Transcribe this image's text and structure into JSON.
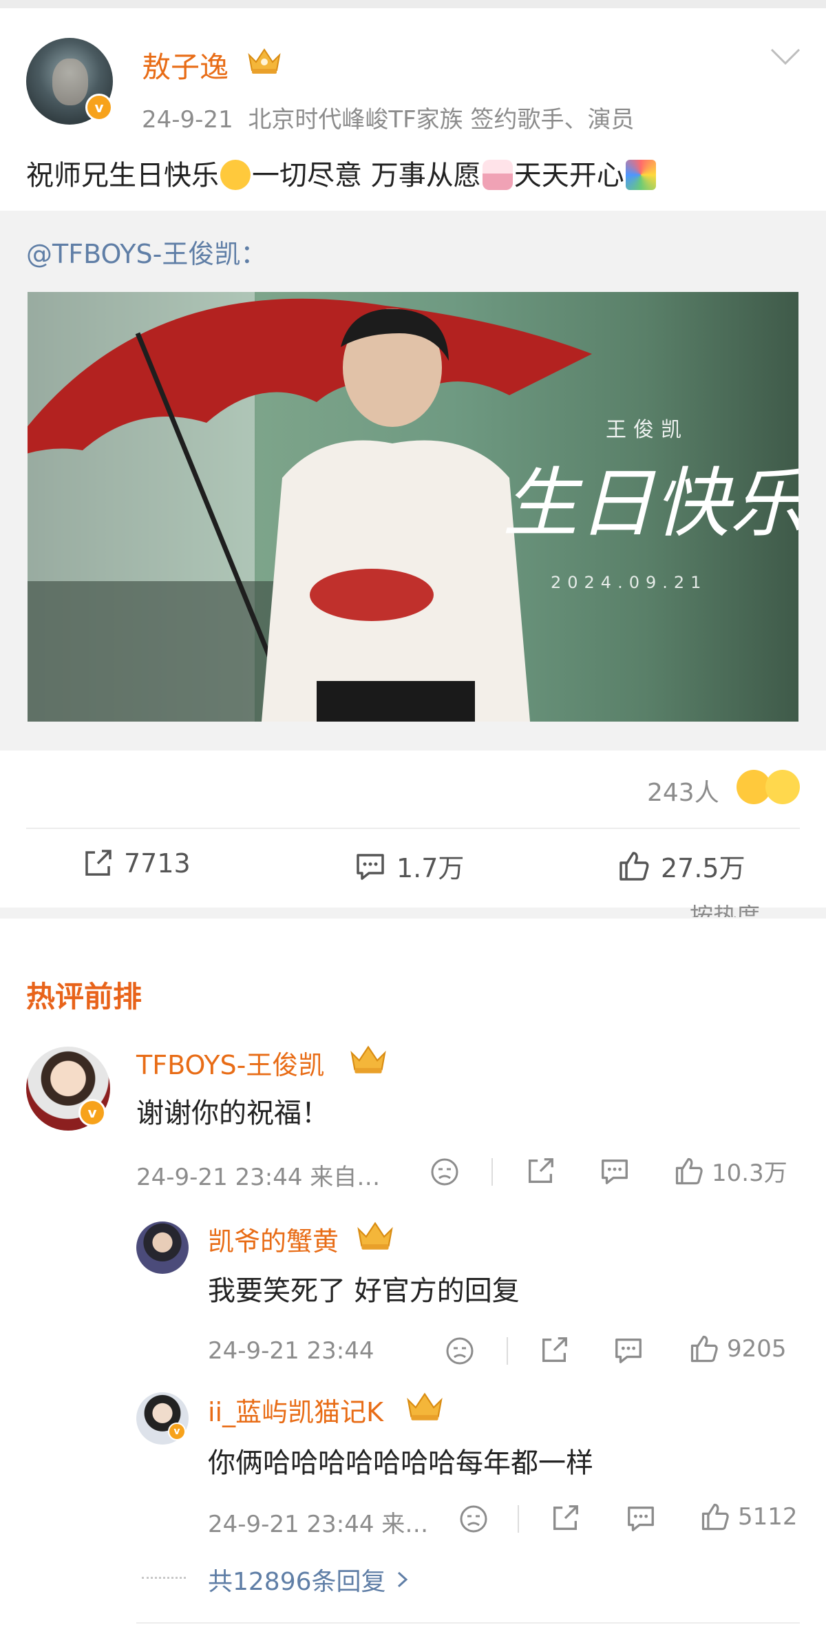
{
  "post": {
    "author": "敖子逸",
    "date": "24-9-21",
    "bio": "北京时代峰峻TF家族 签约歌手、演员",
    "text_part1": "祝师兄生日快乐",
    "text_part2": "一切尽意 万事从愿",
    "text_part3": "天天开心",
    "repost": {
      "author": "@TFBOYS-王俊凯：",
      "image_name": "王俊凯",
      "image_title": "生日快乐",
      "image_date": "2024.09.21"
    },
    "reaction_count": "243人",
    "actions": {
      "repost": "7713",
      "comment": "1.7万",
      "like": "27.5万"
    },
    "sort_label": "按热度"
  },
  "hot_comments": {
    "title": "热评前排",
    "top": {
      "author": "TFBOYS-王俊凯",
      "text": "谢谢你的祝福！",
      "time": "24-9-21 23:44 来自…",
      "likes": "10.3万"
    },
    "replies": [
      {
        "author": "凯爷的蟹黄",
        "text": "我要笑死了 好官方的回复",
        "time": "24-9-21 23:44",
        "likes": "9205"
      },
      {
        "author": "ii_蓝屿凯猫记K",
        "text": "你俩哈哈哈哈哈哈哈每年都一样",
        "time": "24-9-21 23:44 来…",
        "likes": "5112"
      }
    ],
    "more_replies": "共12896条回复"
  },
  "colors": {
    "username": "#e86c16",
    "link": "#5f7ea6",
    "hot_title": "#e8631a",
    "meta": "#8c8c8c",
    "badge": "#f7a21b"
  },
  "icons": [
    "chevron-down-icon",
    "repost-icon",
    "comment-icon",
    "like-icon",
    "dislike-icon",
    "share-icon",
    "crown-icon",
    "verified-icon",
    "chevron-right-icon"
  ]
}
